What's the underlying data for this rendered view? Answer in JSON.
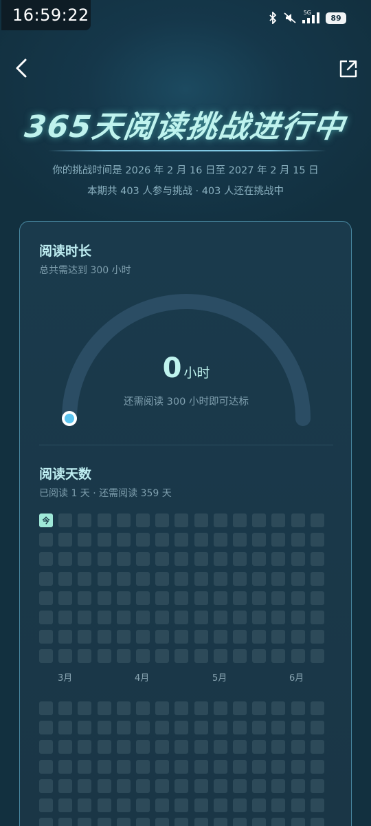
{
  "status_bar": {
    "time": "16:59:22",
    "network": "5G",
    "battery": "89"
  },
  "header": {
    "title": "365天阅读挑战进行中",
    "period_text": "你的挑战时间是 2026 年 2 月 16 日至 2027 年 2 月 15 日",
    "participants_text": "本期共 403 人参与挑战  ·  403 人还在挑战中"
  },
  "reading_time": {
    "title": "阅读时长",
    "subtitle": "总共需达到 300 小时",
    "hours": "0",
    "unit": "小时",
    "remaining_text": "还需阅读 300 小时即可达标",
    "progress_fraction": 0.0
  },
  "reading_days": {
    "title": "阅读天数",
    "subtitle": "已阅读 1 天 ·  还需阅读 359 天",
    "today_label": "今",
    "months": [
      "3月",
      "4月",
      "5月",
      "6月"
    ],
    "days_read": 1
  },
  "colors": {
    "accent": "#9fe8d8",
    "cell": "#2d4a59",
    "gauge_track": "#2b4d64",
    "gauge_dot": "#5cc4ef"
  }
}
